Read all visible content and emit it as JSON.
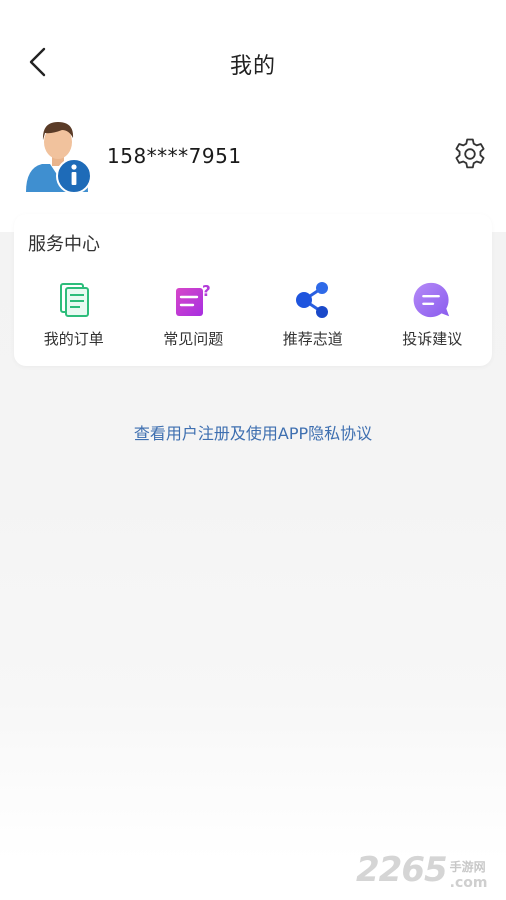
{
  "header": {
    "title": "我的",
    "back_icon": "chevron-left-icon"
  },
  "profile": {
    "phone": "158****7951",
    "avatar_icon": "user-info-avatar-icon",
    "settings_icon": "gear-icon"
  },
  "service_center": {
    "title": "服务中心",
    "items": [
      {
        "label": "我的订单",
        "icon": "order-document-icon",
        "color": "#2dbd7b"
      },
      {
        "label": "常见问题",
        "icon": "faq-question-icon",
        "color": "#c23bd8"
      },
      {
        "label": "推荐志道",
        "icon": "share-nodes-icon",
        "color": "#1f5be0"
      },
      {
        "label": "投诉建议",
        "icon": "chat-bubble-icon",
        "color": "#9b6cf0"
      }
    ]
  },
  "privacy_link": "查看用户注册及使用APP隐私协议",
  "watermark": {
    "number": "2265",
    "site": "手游网",
    "domain": ".com"
  },
  "colors": {
    "link": "#3e6fb0",
    "background": "#f4f4f4",
    "card": "#ffffff"
  }
}
